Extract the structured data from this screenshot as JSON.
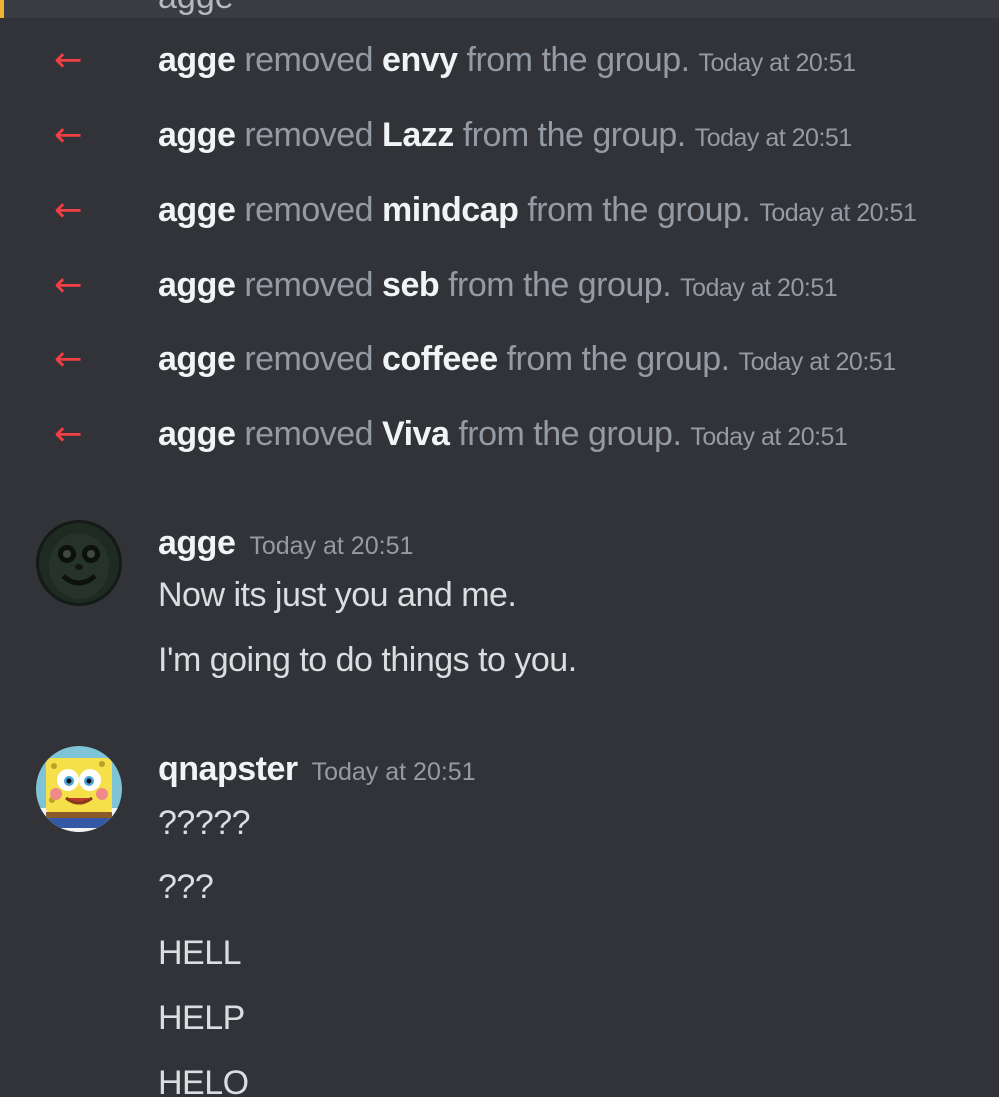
{
  "top_partial": {
    "text": "agge"
  },
  "system_messages": [
    {
      "actor": "agge",
      "verb": "removed",
      "target": "envy",
      "suffix": "from the group.",
      "time": "Today at 20:51"
    },
    {
      "actor": "agge",
      "verb": "removed",
      "target": "Lazz",
      "suffix": "from the group.",
      "time": "Today at 20:51"
    },
    {
      "actor": "agge",
      "verb": "removed",
      "target": "mindcap",
      "suffix": "from the group.",
      "time": "Today at 20:51"
    },
    {
      "actor": "agge",
      "verb": "removed",
      "target": "seb",
      "suffix": "from the group.",
      "time": "Today at 20:51"
    },
    {
      "actor": "agge",
      "verb": "removed",
      "target": "coffeee",
      "suffix": "from the group.",
      "time": "Today at 20:51"
    },
    {
      "actor": "agge",
      "verb": "removed",
      "target": "Viva",
      "suffix": "from the group.",
      "time": "Today at 20:51"
    }
  ],
  "message_groups": [
    {
      "username": "agge",
      "time": "Today at 20:51",
      "avatar_icon": "dark-face-avatar",
      "lines": [
        "Now its just you and me.",
        "I'm going to do things to you."
      ]
    },
    {
      "username": "qnapster",
      "time": "Today at 20:51",
      "avatar_icon": "spongebob-avatar",
      "lines": [
        "?????",
        "???",
        "HELL",
        "HELP",
        "HELO"
      ]
    }
  ],
  "colors": {
    "background": "#313338",
    "removed_arrow": "#f23f43",
    "muted_text": "#949ba4",
    "bright_text": "#f2f3f5"
  }
}
